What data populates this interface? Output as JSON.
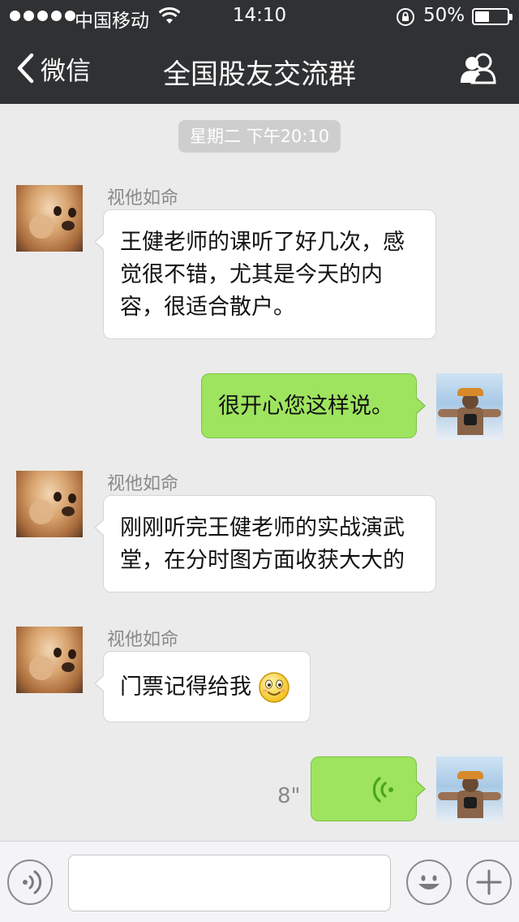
{
  "status_bar": {
    "carrier": "中国移动",
    "time": "14:10",
    "battery_percent": "50%",
    "battery_level": 0.5
  },
  "nav": {
    "back_label": "微信",
    "title": "全国股友交流群"
  },
  "chat": {
    "timestamp": "星期二 下午20:10",
    "messages": [
      {
        "direction": "incoming",
        "sender": "视他如命",
        "lines": [
          "王健老师的课听了好几次，感",
          "觉很不错，尤其是今天的内",
          "容，很适合散户。"
        ]
      },
      {
        "direction": "outgoing",
        "lines": [
          "很开心您这样说。"
        ]
      },
      {
        "direction": "incoming",
        "sender": "视他如命",
        "lines": [
          "刚刚听完王健老师的实战演武",
          "堂，在分时图方面收获大大的"
        ]
      },
      {
        "direction": "incoming",
        "sender": "视他如命",
        "lines": [
          "门票记得给我"
        ],
        "emoji": "smiley-icon"
      },
      {
        "direction": "outgoing",
        "type": "voice",
        "duration": "8\""
      }
    ]
  },
  "input_bar": {
    "voice_button_icon": "voice-mode-icon",
    "emoji_button_icon": "emoji-icon",
    "plus_button_icon": "plus-icon",
    "placeholder": ""
  },
  "colors": {
    "header": "#2f3133",
    "background": "#ebebeb",
    "outgoing_bubble": "#9ee45f",
    "incoming_bubble": "#ffffff"
  }
}
